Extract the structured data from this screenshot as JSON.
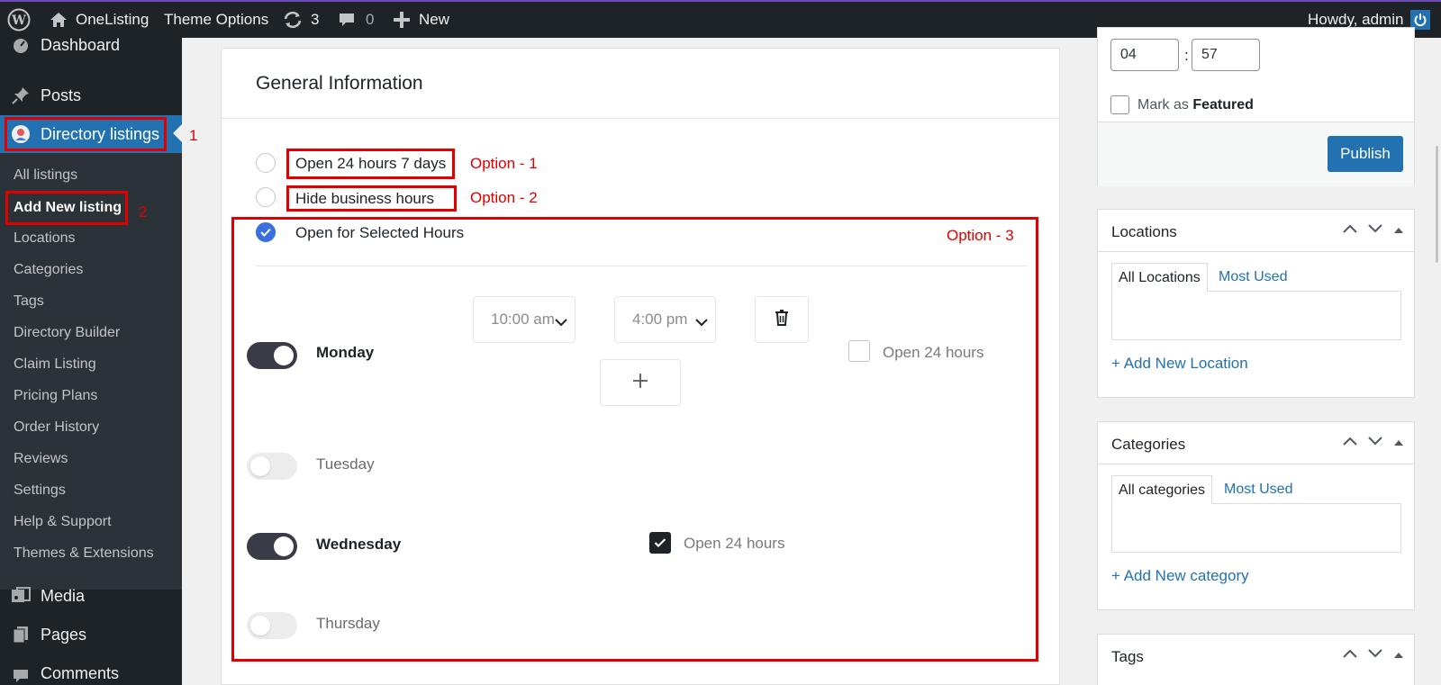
{
  "adminbar": {
    "site_name": "OneListing",
    "theme_options": "Theme Options",
    "updates_count": "3",
    "comments_count": "0",
    "new_label": "New",
    "howdy": "Howdy, admin"
  },
  "sidebar": {
    "dashboard": "Dashboard",
    "posts": "Posts",
    "directory_listings": "Directory listings",
    "submenu": [
      "All listings",
      "Add New listing",
      "Locations",
      "Categories",
      "Tags",
      "Directory Builder",
      "Claim Listing",
      "Pricing Plans",
      "Order History",
      "Reviews",
      "Settings",
      "Help & Support",
      "Themes & Extensions"
    ],
    "media": "Media",
    "pages": "Pages",
    "comments": "Comments"
  },
  "annotations": {
    "n1": "1",
    "n2": "2",
    "option1": "Option - 1",
    "option2": "Option - 2",
    "option3": "Option - 3",
    "color": "#e00000"
  },
  "main": {
    "title": "General Information",
    "options": [
      "Open 24 hours 7 days",
      "Hide business hours",
      "Open for Selected Hours"
    ],
    "selected_option": "Open for Selected Hours",
    "days": [
      {
        "name": "Monday",
        "enabled": true,
        "open_time": "10:00 am",
        "close_time": "4:00 pm",
        "open_24_label": "Open 24 hours",
        "open_24": false
      },
      {
        "name": "Tuesday",
        "enabled": false
      },
      {
        "name": "Wednesday",
        "enabled": true,
        "open_24_label": "Open 24 hours",
        "open_24": true
      },
      {
        "name": "Thursday",
        "enabled": false
      }
    ]
  },
  "publish": {
    "hour": "04",
    "minute": "57",
    "time_sep": ":",
    "featured_label_pre": "Mark as ",
    "featured_label_bold": "Featured",
    "publish_button": "Publish"
  },
  "locations": {
    "title": "Locations",
    "tab_all": "All Locations",
    "tab_used": "Most Used",
    "add_link": "+ Add New Location"
  },
  "categories": {
    "title": "Categories",
    "tab_all": "All categories",
    "tab_used": "Most Used",
    "add_link": "+ Add New category"
  },
  "tags": {
    "title": "Tags"
  },
  "colors": {
    "admin_bar": "#1d2327",
    "accent": "#2271b1",
    "toggle_on": "#3a3b47",
    "radio_checked": "#3b6fe0"
  }
}
